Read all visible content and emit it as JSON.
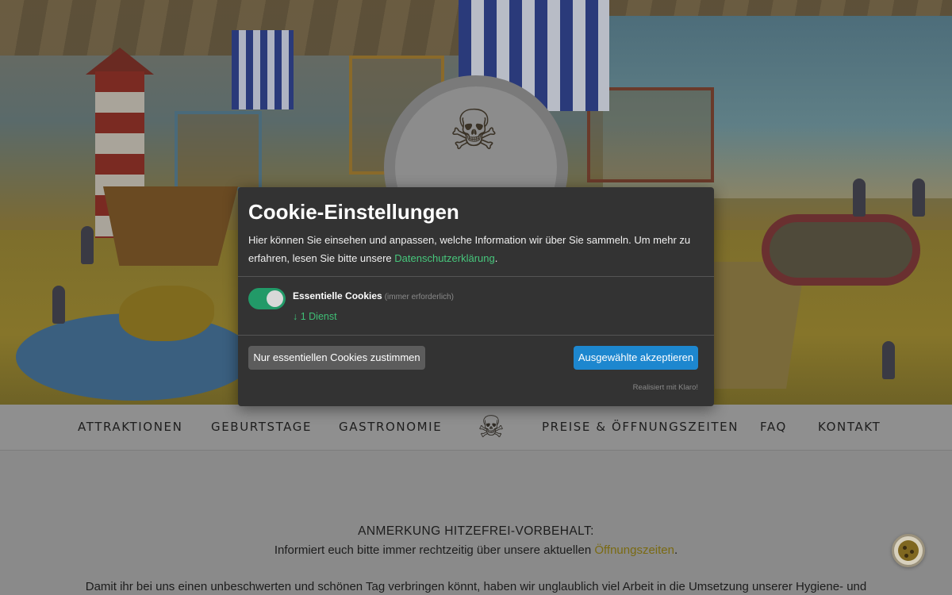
{
  "hero": {
    "alt": "Indoor playground hall with lighthouse, ships and climbing structures"
  },
  "nav": {
    "items": [
      {
        "label": "ATTRAKTIONEN"
      },
      {
        "label": "GEBURTSTAGE"
      },
      {
        "label": "GASTRONOMIE"
      },
      {
        "label": "PREISE & ÖFFNUNGSZEITEN"
      },
      {
        "label": "FAQ"
      },
      {
        "label": "KONTAKT"
      }
    ],
    "logo_icon": "pirate-mascot-icon"
  },
  "content": {
    "note_title": "ANMERKUNG HITZEFREI-VORBEHALT:",
    "note_text_before": "Informiert euch bitte immer rechtzeitig über unsere aktuellen ",
    "note_link": "Öffnungszeiten",
    "note_text_after": ".",
    "paragraph": "Damit ihr bei uns einen unbeschwerten und schönen Tag verbringen könnt, haben wir unglaublich viel Arbeit in die Umsetzung unserer Hygiene- und"
  },
  "cookie_modal": {
    "title": "Cookie-Einstellungen",
    "description": "Hier können Sie einsehen und anpassen, welche Information wir über Sie sammeln. Um mehr zu erfahren, lesen Sie bitte unsere ",
    "privacy_link": "Datenschutzerklärung",
    "description_end": ".",
    "service": {
      "label": "Essentielle Cookies",
      "required_note": "(immer erforderlich)",
      "enabled": true,
      "count_text": "↓ 1 Dienst"
    },
    "decline_button": "Nur essentiellen Cookies zustimmen",
    "accept_button": "Ausgewählte akzeptieren",
    "powered_by": "Realisiert mit Klaro!",
    "colors": {
      "accent_green": "#229a68",
      "accept_blue": "#1d87cf",
      "modal_bg": "#333333"
    }
  },
  "cookie_fab": {
    "icon": "cookie-icon"
  }
}
